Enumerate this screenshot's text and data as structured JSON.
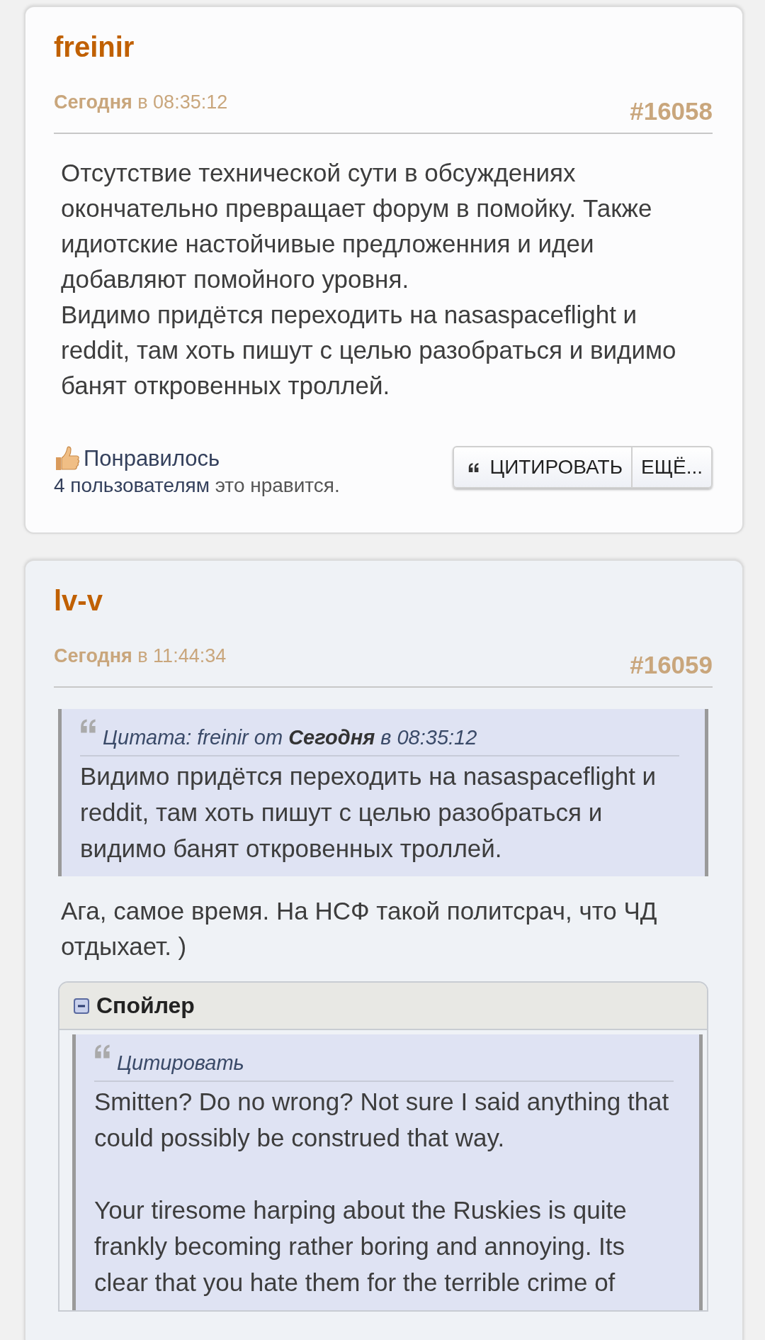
{
  "posts": [
    {
      "author": "freinir",
      "date_day": "Сегодня",
      "date_time": "в 08:35:12",
      "number": "#16058",
      "blocks": [
        {
          "kind": "text",
          "paragraphs": [
            "Отсутствие технической сути в обсуждениях окончательно превращает форум в помойку. Также идиотские настойчивые предложенния и идеи добавляют помойного уровня.",
            "Видимо придётся переходить на nasaspaceflight и reddit, там хоть пишут с целью разобраться и видимо банят откровенных троллей."
          ]
        }
      ],
      "like": {
        "label": "Понравилось",
        "count_link": "4 пользователям",
        "count_rest": "это нравится."
      },
      "buttons": [
        "ЦИТИРОВАТЬ",
        "ЕЩЁ..."
      ]
    },
    {
      "author": "lv-v",
      "date_day": "Сегодня",
      "date_time": "в 11:44:34",
      "number": "#16059",
      "blocks": [
        {
          "kind": "quote",
          "header": "Цитата: freinir от **Сегодня** в 08:35:12",
          "paragraphs": [
            "Видимо придётся переходить на nasaspaceflight и reddit, там хоть пишут с целью разобраться и видимо банят откровенных троллей."
          ]
        },
        {
          "kind": "text",
          "paragraphs": [
            "Ага, самое время. На НСФ такой политсрач, что ЧД отдыхает.  )"
          ]
        },
        {
          "kind": "spoiler",
          "title": "Спойлер",
          "expanded": true,
          "blocks": [
            {
              "kind": "quote",
              "header": "Цитировать",
              "paragraphs": [
                "Smitten? Do no wrong?  Not sure I said anything that could possibly be construed that way.",
                "Your tiresome harping about the Ruskies is quite frankly becoming rather boring and annoying.  Its clear that you hate them for the terrible crime of"
              ]
            }
          ]
        }
      ]
    }
  ]
}
